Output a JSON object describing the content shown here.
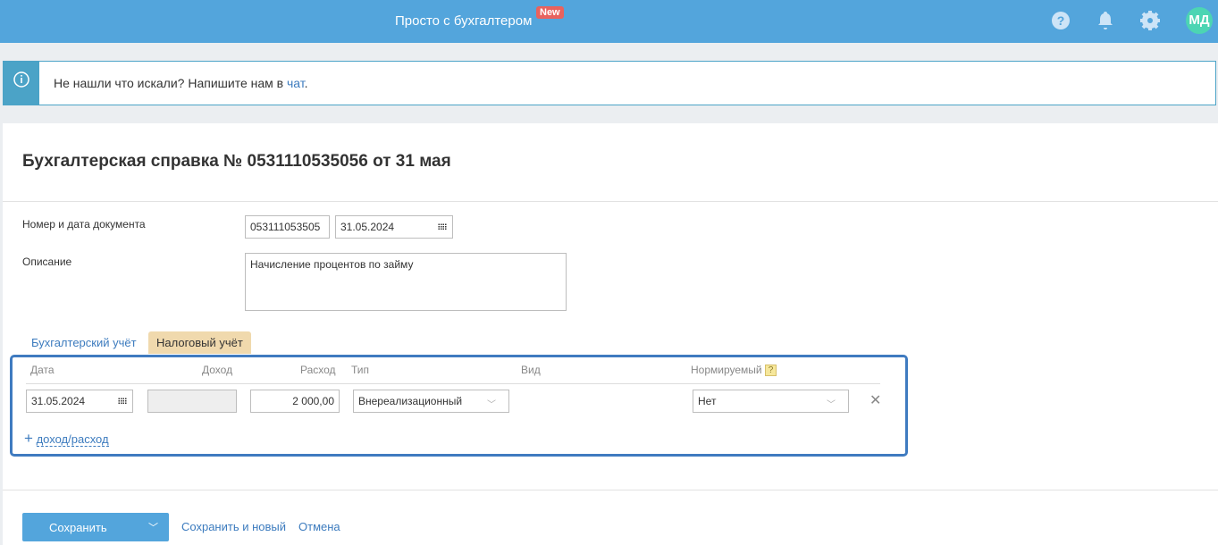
{
  "header": {
    "brand": "Просто с бухгалтером",
    "badge": "New",
    "avatar": "МД"
  },
  "info": {
    "text": "Не нашли что искали? Напишите нам в ",
    "link": "чат",
    "end": "."
  },
  "title": "Бухгалтерская справка № 0531110535056 от 31 мая",
  "form": {
    "number_label": "Номер и дата документа",
    "number": "053111053505",
    "date": "31.05.2024",
    "desc_label": "Описание",
    "desc": "Начисление процентов по займу"
  },
  "tabs": [
    "Бухгалтерский учёт",
    "Налоговый учёт"
  ],
  "table": {
    "headers": {
      "date": "Дата",
      "income": "Доход",
      "expense": "Расход",
      "type": "Тип",
      "kind": "Вид",
      "norm": "Нормируемый",
      "help": "?"
    },
    "row": {
      "date": "31.05.2024",
      "income": "",
      "expense": "2 000,00",
      "type": "Внереализационный",
      "norm": "Нет"
    },
    "add": "доход/расход"
  },
  "footer": {
    "save": "Сохранить",
    "save_new": "Сохранить и новый",
    "cancel": "Отмена"
  }
}
